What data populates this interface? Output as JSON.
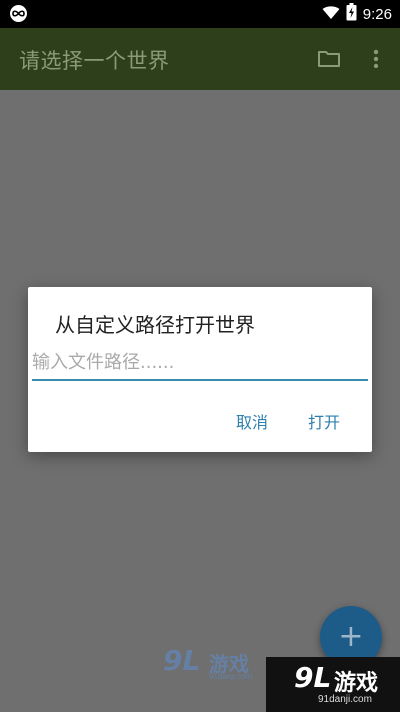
{
  "status_bar": {
    "time": "9:26",
    "icons": [
      "app-notification-icon",
      "wifi-icon",
      "battery-charging-icon"
    ]
  },
  "toolbar": {
    "title": "请选择一个世界",
    "actions": [
      "folder-icon",
      "more-vert-icon"
    ]
  },
  "dialog": {
    "title": "从自定义路径打开世界",
    "input": {
      "value": "",
      "placeholder": "输入文件路径......"
    },
    "cancel_label": "取消",
    "open_label": "打开"
  },
  "fab": {
    "label": "+"
  },
  "watermark": {
    "logo": "9L",
    "text": "游戏",
    "url": "91danji.com"
  },
  "colors": {
    "toolbar_bg": "#2d3f1b",
    "toolbar_title": "#8b9b7a",
    "scrim_bg": "#6f6f6f",
    "accent": "#2f7fae",
    "input_underline": "#3a8bb0",
    "fab_bg": "#1d5c89"
  }
}
